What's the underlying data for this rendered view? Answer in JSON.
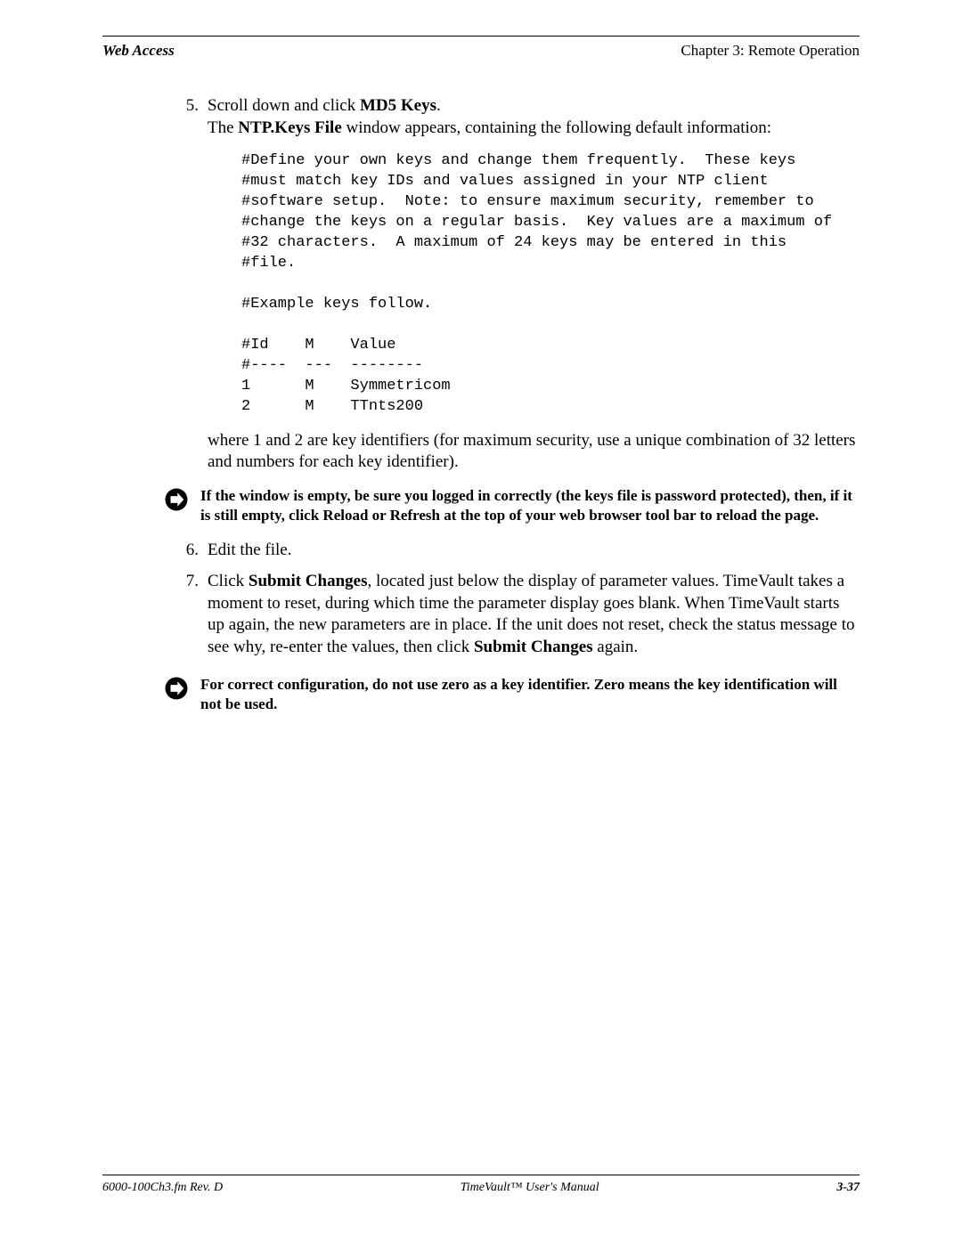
{
  "header": {
    "left": "Web Access",
    "right": "Chapter 3: Remote Operation"
  },
  "steps": {
    "s5": {
      "num": "5.",
      "l1a": "Scroll down and click ",
      "l1b": "MD5 Keys",
      "l1c": ".",
      "l2a": "The ",
      "l2b": "NTP.Keys File",
      "l2c": " window appears, containing the following default information:"
    },
    "code": "#Define your own keys and change them frequently.  These keys\n#must match key IDs and values assigned in your NTP client\n#software setup.  Note: to ensure maximum security, remember to\n#change the keys on a regular basis.  Key values are a maximum of\n#32 characters.  A maximum of 24 keys may be entered in this\n#file.\n\n#Example keys follow.\n\n#Id    M    Value\n#----  ---  --------\n1      M    Symmetricom\n2      M    TTnts200",
    "afterCode": "where 1 and 2 are key identifiers (for maximum security, use a unique combination of 32 letters and numbers for each key identifier).",
    "note1": "If the window is empty, be sure you logged in correctly (the keys file is password protected), then, if it is still empty, click Reload or Refresh at the top of your web browser tool bar to reload the page.",
    "s6": {
      "num": "6.",
      "text": "Edit the file."
    },
    "s7": {
      "num": "7.",
      "l1a": "Click ",
      "l1b": "Submit Changes",
      "l1c": ", located just below the display of parameter values.  TimeVault takes a moment to reset, during which time the parameter display goes blank.  When TimeVault starts up again, the new parameters are in place.  If the unit does not reset, check the status message to see why, re-enter the values, then click ",
      "l1d": "Submit Changes",
      "l1e": " again."
    },
    "note2": "For correct configuration, do not use zero as a key identifier.  Zero means the key identification will not be used."
  },
  "footer": {
    "left": "6000-100Ch3.fm  Rev. D",
    "center": "TimeVault™ User's Manual",
    "right": "3-37"
  }
}
